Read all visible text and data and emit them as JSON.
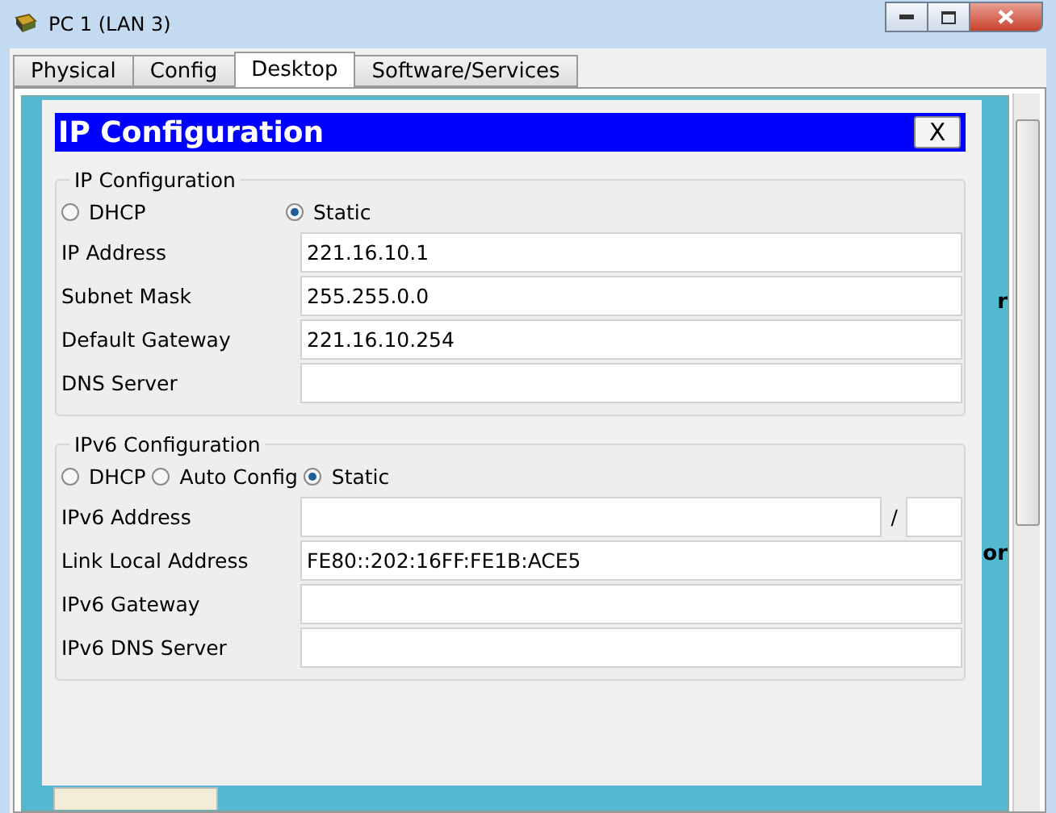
{
  "window": {
    "title": "PC 1 (LAN 3)"
  },
  "tabs": [
    {
      "label": "Physical",
      "selected": false
    },
    {
      "label": "Config",
      "selected": false
    },
    {
      "label": "Desktop",
      "selected": true
    },
    {
      "label": "Software/Services",
      "selected": false
    }
  ],
  "dialog": {
    "title": "IP Configuration",
    "close": "X",
    "ipv4": {
      "legend": "IP Configuration",
      "modes": [
        {
          "label": "DHCP",
          "selected": false
        },
        {
          "label": "Static",
          "selected": true
        }
      ],
      "fields": [
        {
          "label": "IP Address",
          "value": "221.16.10.1"
        },
        {
          "label": "Subnet Mask",
          "value": "255.255.0.0"
        },
        {
          "label": "Default Gateway",
          "value": "221.16.10.254"
        },
        {
          "label": "DNS Server"
        }
      ]
    },
    "ipv6": {
      "legend": "IPv6 Configuration",
      "modes": [
        {
          "label": "DHCP",
          "selected": false
        },
        {
          "label": "Auto Config",
          "selected": false
        },
        {
          "label": "Static",
          "selected": true
        }
      ],
      "fields": [
        {
          "label": "IPv6 Address",
          "kind": "prefix",
          "separator": "/"
        },
        {
          "label": "Link Local Address",
          "value": "FE80::202:16FF:FE1B:ACE5"
        },
        {
          "label": "IPv6 Gateway"
        },
        {
          "label": "IPv6 DNS Server"
        }
      ]
    }
  },
  "desktop_fragments": [
    "r",
    "or"
  ]
}
